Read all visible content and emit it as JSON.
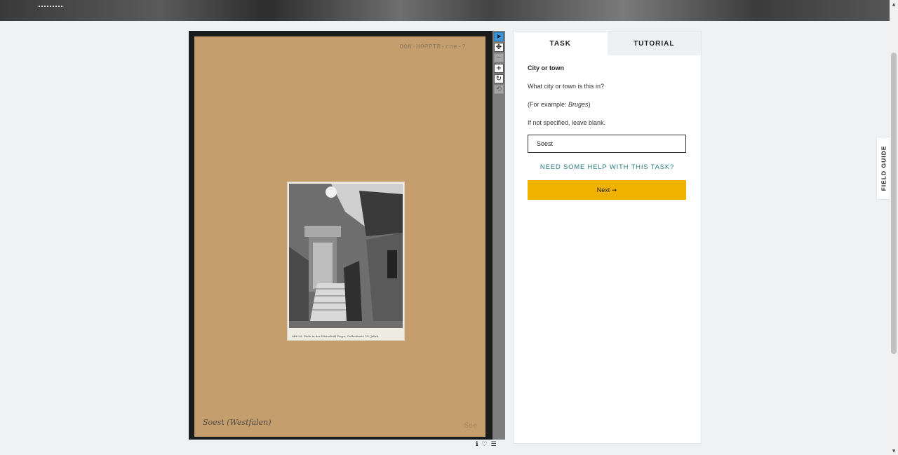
{
  "viewer": {
    "card_stamp": "OON-H0PPTR-rne-?",
    "card_caption": "Soest (Westfalen)",
    "card_mark": "Soe",
    "photo_caption": "Abb 99.  Diele in der Wirtschaft Freye, Osthofenstr.  18. Jahrh.",
    "tools": [
      {
        "icon": "pointer-icon",
        "glyph": "➤",
        "state": "active"
      },
      {
        "icon": "move-icon",
        "glyph": "✥",
        "state": "normal"
      },
      {
        "icon": "zoom-out-icon",
        "glyph": "−",
        "state": "disabled"
      },
      {
        "icon": "zoom-in-icon",
        "glyph": "+",
        "state": "normal"
      },
      {
        "icon": "rotate-icon",
        "glyph": "↻",
        "state": "normal"
      },
      {
        "icon": "reset-icon",
        "glyph": "⟲",
        "state": "disabled"
      }
    ],
    "meta_icons": [
      {
        "icon": "info-icon",
        "glyph": "ℹ"
      },
      {
        "icon": "heart-icon",
        "glyph": "♡"
      },
      {
        "icon": "collections-icon",
        "glyph": "☰"
      }
    ]
  },
  "panel": {
    "tabs": [
      {
        "label": "TASK",
        "active": true
      },
      {
        "label": "TUTORIAL",
        "active": false
      }
    ],
    "task": {
      "title": "City or town",
      "question": "What city or town is this in?",
      "example_prefix": "(For example: ",
      "example_value": "Bruges",
      "example_suffix": ")",
      "hint": "If not specified, leave blank.",
      "answer_value": "Soest",
      "help_link": "NEED SOME HELP WITH THIS TASK?",
      "next_label": "Next ➞"
    }
  },
  "field_guide": {
    "label": "FIELD GUIDE"
  },
  "colors": {
    "page_bg": "#eff2f5",
    "card": "#c59e6d",
    "next_button": "#f0b200",
    "help_link": "#2a7c83",
    "active_tool": "#3b95d6"
  }
}
